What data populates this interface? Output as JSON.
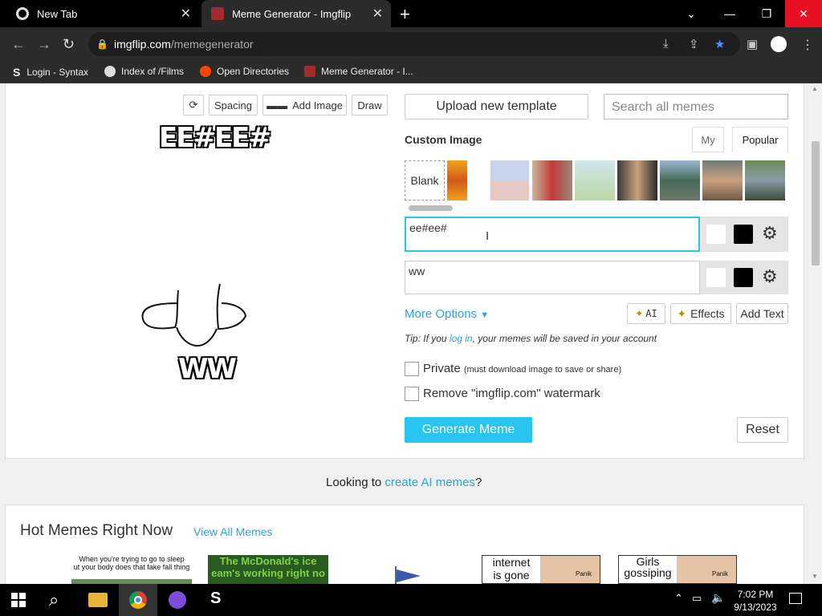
{
  "browser": {
    "tabs": [
      {
        "title": "New Tab",
        "active": false
      },
      {
        "title": "Meme Generator - Imgflip",
        "active": true
      }
    ],
    "url_domain": "imgflip.com",
    "url_path": "/memegenerator",
    "bookmarks": [
      "Login - Syntax",
      "Index of /Films",
      "Open Directories",
      "Meme Generator - I..."
    ],
    "colors": {
      "titlebar": "#000000",
      "toolbar": "#2b2b2b",
      "bookmark_star": "#4d8fff"
    }
  },
  "editor": {
    "buttons": {
      "spacing": "Spacing",
      "add_image": "Add Image",
      "draw": "Draw"
    },
    "meme_top_text": "EE#EE#",
    "meme_bottom_text": "WW"
  },
  "sidebar": {
    "upload_template": "Upload new template",
    "search_placeholder": "Search all memes",
    "custom_image_label": "Custom Image",
    "tab_my": "My",
    "tab_popular": "Popular",
    "blank_label": "Blank",
    "textbox1_value": "ee#ee#",
    "textbox2_value": "ww",
    "more_options": "More Options",
    "ai_button": "AI",
    "effects_button": "Effects",
    "add_text_button": "Add Text",
    "tip_prefix": "Tip: If you ",
    "tip_link": "log in",
    "tip_suffix": ", your memes will be saved in your account",
    "private_label": "Private",
    "private_note": "(must download image to save or share)",
    "watermark_label": "Remove \"imgflip.com\" watermark",
    "generate_button": "Generate Meme",
    "reset_button": "Reset",
    "accent_color": "#27c5f0"
  },
  "footer": {
    "looking_prefix": "Looking to ",
    "looking_link": "create AI memes",
    "looking_suffix": "?",
    "hot_memes_title": "Hot Memes Right Now",
    "view_all": "View All Memes",
    "meme_captions": [
      "When you're trying to go to sleep",
      "ut your body does that fake fall thing",
      "The McDonald's ice",
      "eam's working right no",
      "internet",
      "is gone",
      "Panik",
      "Girls",
      "gossiping",
      "Panik"
    ]
  },
  "taskbar": {
    "time": "7:02 PM",
    "date": "9/13/2023"
  }
}
